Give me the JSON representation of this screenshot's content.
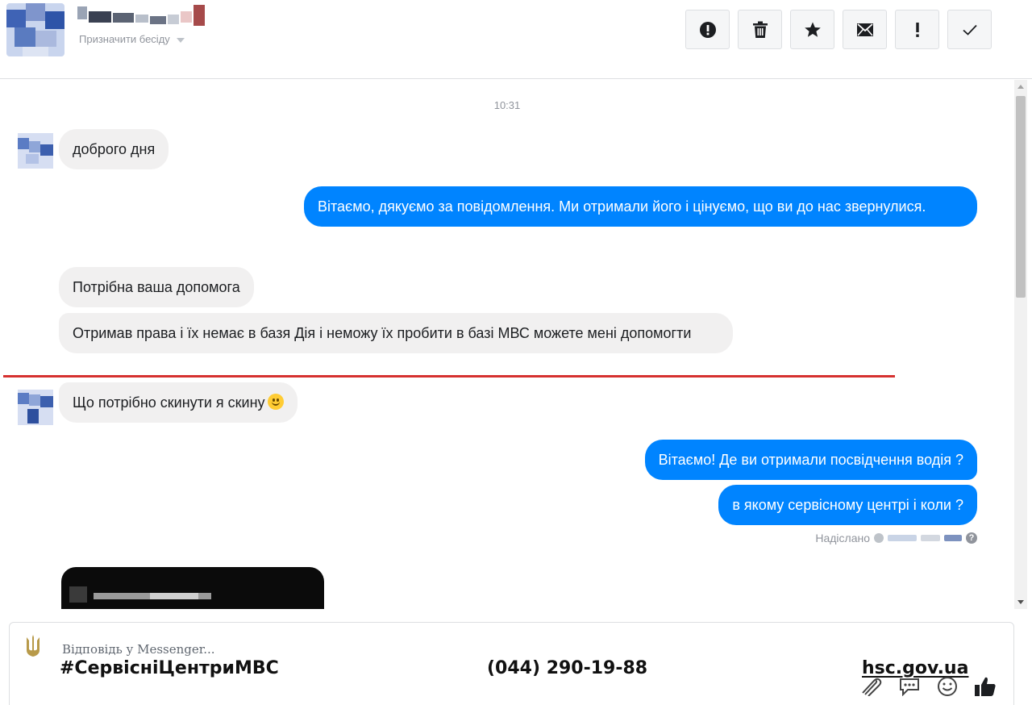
{
  "header": {
    "assign_label": "Призначити бесіду",
    "toolbar": [
      {
        "name": "spam-button",
        "icon": "alert-circle-icon"
      },
      {
        "name": "delete-button",
        "icon": "trash-icon"
      },
      {
        "name": "star-button",
        "icon": "star-icon"
      },
      {
        "name": "mark-unread-button",
        "icon": "envelope-icon"
      },
      {
        "name": "follow-up-button",
        "icon": "exclamation-icon"
      },
      {
        "name": "mark-done-button",
        "icon": "check-icon"
      }
    ]
  },
  "conversation": {
    "timestamp": "10:31",
    "messages": [
      {
        "from": "customer",
        "text": "доброго дня"
      },
      {
        "from": "page",
        "text": "Вітаємо, дякуємо за повідомлення. Ми отримали його і цінуємо, що ви до нас звернулися."
      },
      {
        "from": "customer",
        "text": "Потрібна ваша допомога"
      },
      {
        "from": "customer",
        "text": "Отримав права і їх немає в базя Дія і неможу їх пробити в базі МВС можете мені допомогти"
      },
      {
        "from": "customer",
        "text": "Що потрібно скинути я скину"
      },
      {
        "from": "page",
        "text": "Вітаємо!  Де ви отримали посвідчення водія ?"
      },
      {
        "from": "page",
        "text": "в якому сервісному центрі і коли ?"
      }
    ],
    "sent_status": "Надіслано"
  },
  "composer": {
    "placeholder": "Відповідь у Messenger..."
  },
  "branding": {
    "hashtag": "#СервісніЦентриМВС",
    "phone": "(044) 290-19-88",
    "website": "hsc.gov.ua"
  },
  "colors": {
    "outgoing_bubble": "#0084ff",
    "incoming_bubble": "#f1f0f0",
    "annotation_line": "#d6312f"
  }
}
